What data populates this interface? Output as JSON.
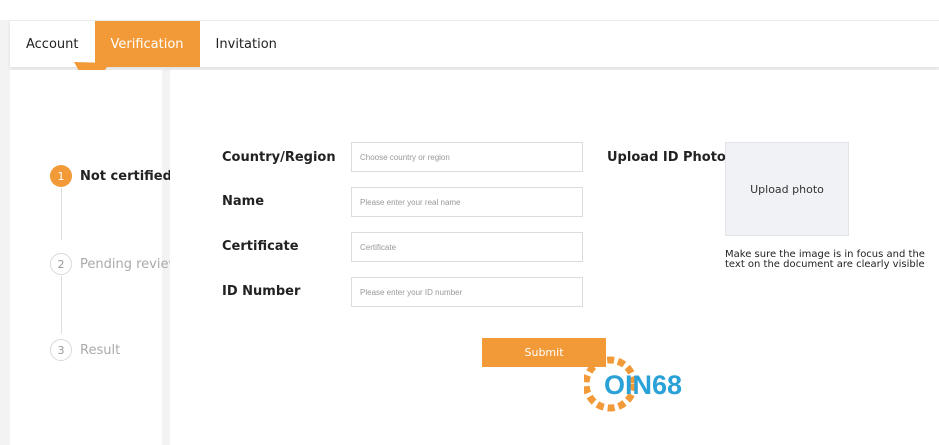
{
  "tabs": [
    {
      "label": "Account",
      "active": false
    },
    {
      "label": "Verification",
      "active": true
    },
    {
      "label": "Invitation",
      "active": false
    }
  ],
  "steps": [
    {
      "number": "1",
      "label": "Not certified",
      "state": "active"
    },
    {
      "number": "2",
      "label": "Pending review",
      "state": "inactive"
    },
    {
      "number": "3",
      "label": "Result",
      "state": "inactive"
    }
  ],
  "form": {
    "country": {
      "label": "Country/Region",
      "placeholder": "Choose country or region",
      "value": ""
    },
    "name": {
      "label": "Name",
      "placeholder": "Please enter your real name",
      "value": ""
    },
    "certificate": {
      "label": "Certificate",
      "placeholder": "Certificate",
      "value": ""
    },
    "id_number": {
      "label": "ID Number",
      "placeholder": "Please enter your ID number",
      "value": ""
    }
  },
  "upload": {
    "label": "Upload ID Photo",
    "button": "Upload photo",
    "hint": "Make sure the image is in focus and the text on the document are clearly visible"
  },
  "submit_label": "Submit",
  "watermark": {
    "text": "OIN68"
  },
  "colors": {
    "accent": "#f29a38",
    "watermark_blue": "#2aa1d7"
  },
  "icons": [
    "pointer-arrow-icon",
    "coin68-logo"
  ]
}
